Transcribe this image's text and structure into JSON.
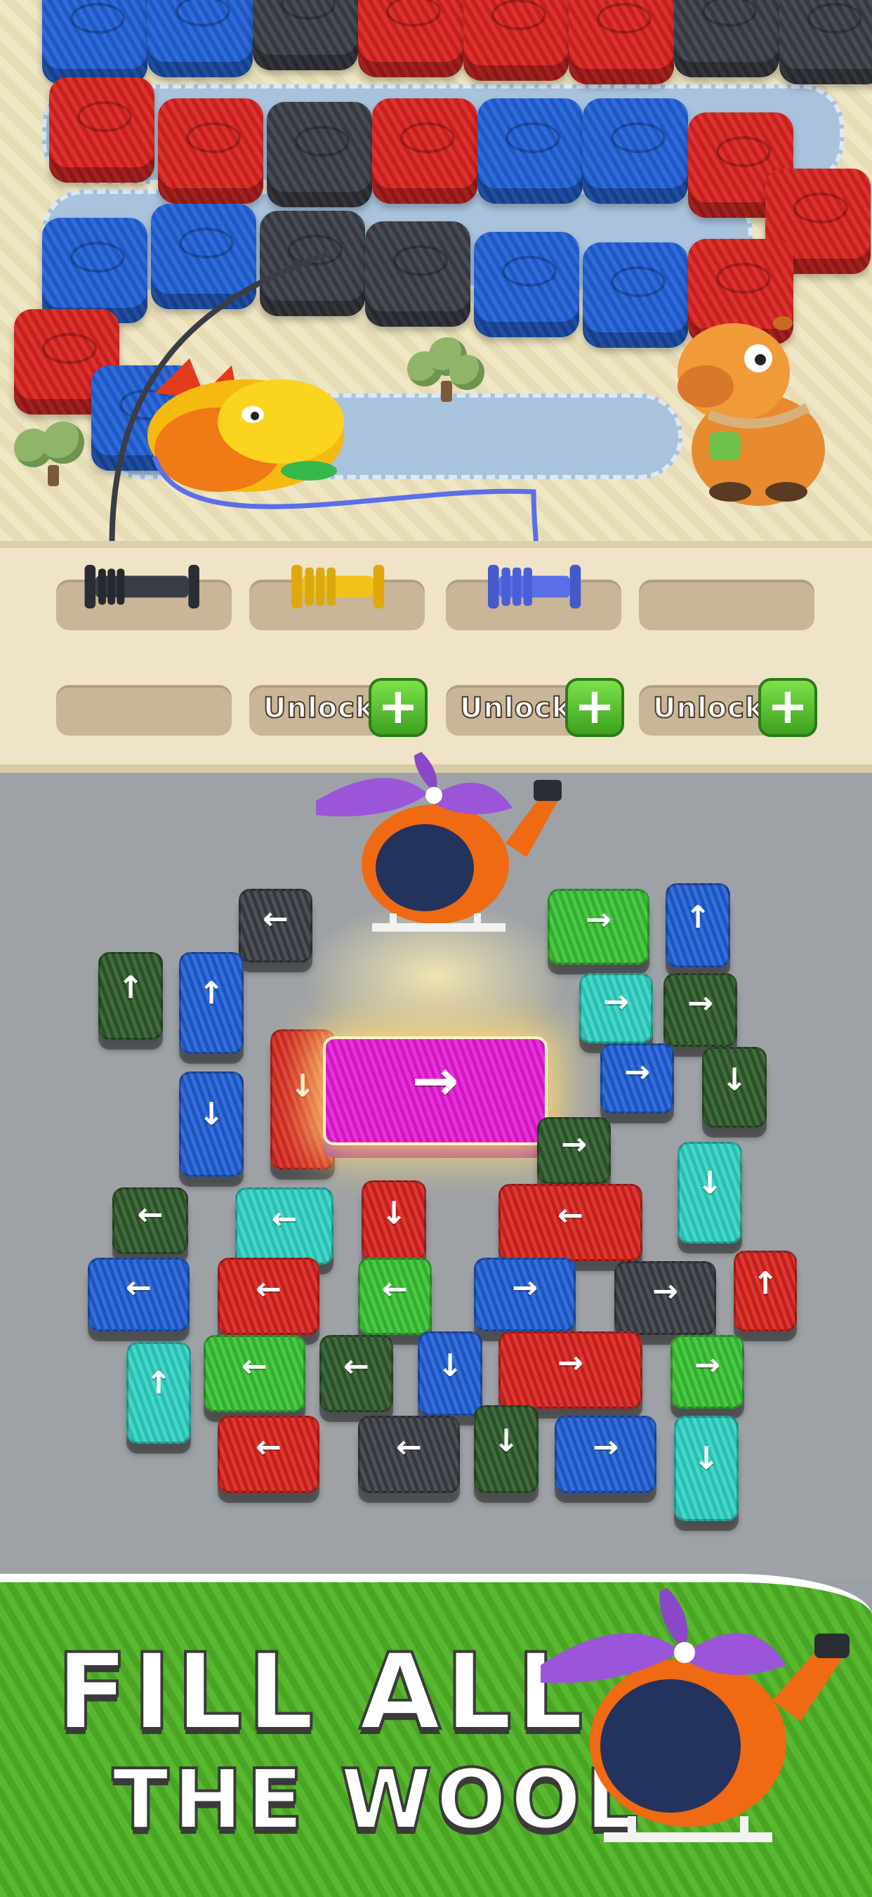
{
  "game": {
    "colors": {
      "red": "#d8221e",
      "blue": "#1f5fd6",
      "black": "#3a3d45",
      "darkgreen": "#2f5a2a",
      "green": "#39c233",
      "teal": "#2fd3c4",
      "magenta": "#e81bd6",
      "yellow": "#f2c21a",
      "periwinkle": "#5b6fe8"
    }
  },
  "slots": {
    "unlock_label": "Unlock",
    "plus_glyph": "+",
    "spools": [
      {
        "color": "black"
      },
      {
        "color": "yellow"
      },
      {
        "color": "periwinkle"
      }
    ]
  },
  "tiles": [
    {
      "arrow": "←",
      "color": "black"
    },
    {
      "arrow": "↑",
      "color": "darkgreen"
    },
    {
      "arrow": "↑",
      "color": "blue"
    },
    {
      "arrow": "↓",
      "color": "red"
    },
    {
      "arrow": "↓",
      "color": "blue"
    },
    {
      "arrow": "→",
      "color": "magenta"
    },
    {
      "arrow": "→",
      "color": "green"
    },
    {
      "arrow": "↑",
      "color": "blue"
    },
    {
      "arrow": "→",
      "color": "teal"
    },
    {
      "arrow": "→",
      "color": "darkgreen"
    },
    {
      "arrow": "→",
      "color": "blue"
    },
    {
      "arrow": "↓",
      "color": "darkgreen"
    },
    {
      "arrow": "→",
      "color": "darkgreen"
    },
    {
      "arrow": "↓",
      "color": "teal"
    },
    {
      "arrow": "←",
      "color": "darkgreen"
    },
    {
      "arrow": "←",
      "color": "teal"
    },
    {
      "arrow": "↓",
      "color": "red"
    },
    {
      "arrow": "←",
      "color": "red"
    },
    {
      "arrow": "←",
      "color": "blue"
    },
    {
      "arrow": "←",
      "color": "red"
    },
    {
      "arrow": "←",
      "color": "green"
    },
    {
      "arrow": "→",
      "color": "blue"
    },
    {
      "arrow": "→",
      "color": "black"
    },
    {
      "arrow": "↑",
      "color": "red"
    },
    {
      "arrow": "↑",
      "color": "teal"
    },
    {
      "arrow": "←",
      "color": "green"
    },
    {
      "arrow": "←",
      "color": "darkgreen"
    },
    {
      "arrow": "↓",
      "color": "blue"
    },
    {
      "arrow": "→",
      "color": "red"
    },
    {
      "arrow": "→",
      "color": "green"
    },
    {
      "arrow": "←",
      "color": "red"
    },
    {
      "arrow": "←",
      "color": "black"
    },
    {
      "arrow": "↓",
      "color": "darkgreen"
    },
    {
      "arrow": "→",
      "color": "blue"
    },
    {
      "arrow": "↓",
      "color": "teal"
    }
  ],
  "banner": {
    "line1": "FILL ALL",
    "line2": "THE WOOL"
  }
}
